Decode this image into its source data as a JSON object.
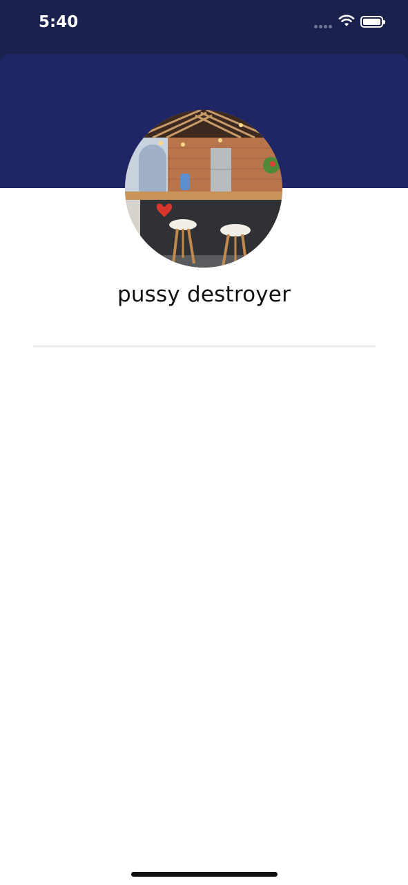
{
  "status_bar": {
    "time": "5:40",
    "signal_icon": "signal-dots-icon",
    "wifi_icon": "wifi-icon",
    "battery_icon": "battery-full-icon"
  },
  "profile": {
    "name": "pussy destroyer",
    "avatar": "profile-photo-kitchen-bar"
  },
  "colors": {
    "status_bar_bg": "#19214d",
    "header_bg": "#1e2666",
    "page_bg": "#ffffff",
    "text": "#111111",
    "divider": "#c8c8c8"
  }
}
